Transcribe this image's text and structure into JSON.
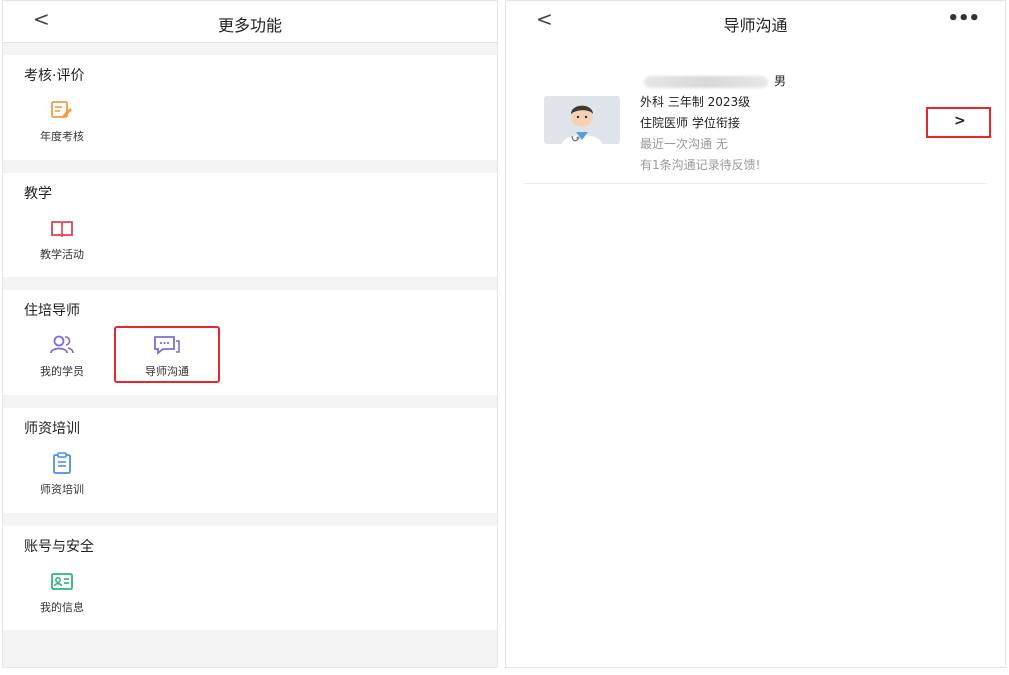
{
  "left": {
    "back": "<",
    "title": "更多功能",
    "sections": [
      {
        "title": "考核·评价",
        "items": [
          {
            "label": "年度考核",
            "icon": "edit-note-icon"
          }
        ]
      },
      {
        "title": "教学",
        "items": [
          {
            "label": "教学活动",
            "icon": "open-book-icon"
          }
        ]
      },
      {
        "title": "住培导师",
        "items": [
          {
            "label": "我的学员",
            "icon": "users-icon"
          },
          {
            "label": "导师沟通",
            "icon": "chat-icon"
          }
        ]
      },
      {
        "title": "师资培训",
        "items": [
          {
            "label": "师资培训",
            "icon": "clipboard-icon"
          }
        ]
      },
      {
        "title": "账号与安全",
        "items": [
          {
            "label": "我的信息",
            "icon": "id-card-icon"
          }
        ]
      }
    ]
  },
  "right": {
    "back": "<",
    "title": "导师沟通",
    "more": "•••",
    "student": {
      "gender": "男",
      "line1": "外科 三年制 2023级",
      "line2": "住院医师 学位衔接",
      "line3": "最近一次沟通  无",
      "line4": "有1条沟通记录待反馈!",
      "arrow": ">"
    }
  },
  "colors": {
    "highlight": "#e8262b",
    "orange": "#f39a44",
    "red_icon": "#e0415a",
    "purple_icon": "#7b6fd6",
    "blue_icon": "#4a8fe0",
    "green_icon": "#2fb37a"
  }
}
